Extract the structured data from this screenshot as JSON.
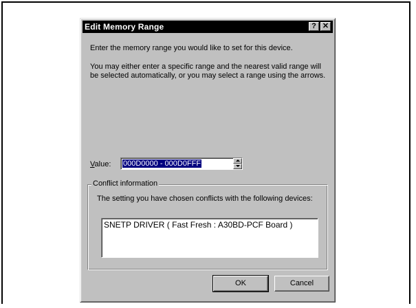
{
  "dialog": {
    "title": "Edit Memory Range",
    "help_glyph": "?",
    "close_glyph": "✕",
    "instruction": "Enter the memory range you would like to set for this device.",
    "description": "You may either enter a specific range and the nearest valid range will be selected automatically, or you may select a range using the arrows.",
    "value_label_accel": "V",
    "value_label_rest": "alue:",
    "value": "000D0000 - 000D0FFF",
    "conflict": {
      "legend": "Conflict information",
      "description": "The setting you have chosen conflicts with the following devices:",
      "devices": [
        "SNETP DRIVER ( Fast Fresh : A30BD-PCF Board )"
      ]
    },
    "buttons": {
      "ok": "OK",
      "cancel": "Cancel"
    }
  },
  "colors": {
    "face": "#c0c0c0",
    "titlebar": "#000000",
    "selection": "#000080"
  }
}
